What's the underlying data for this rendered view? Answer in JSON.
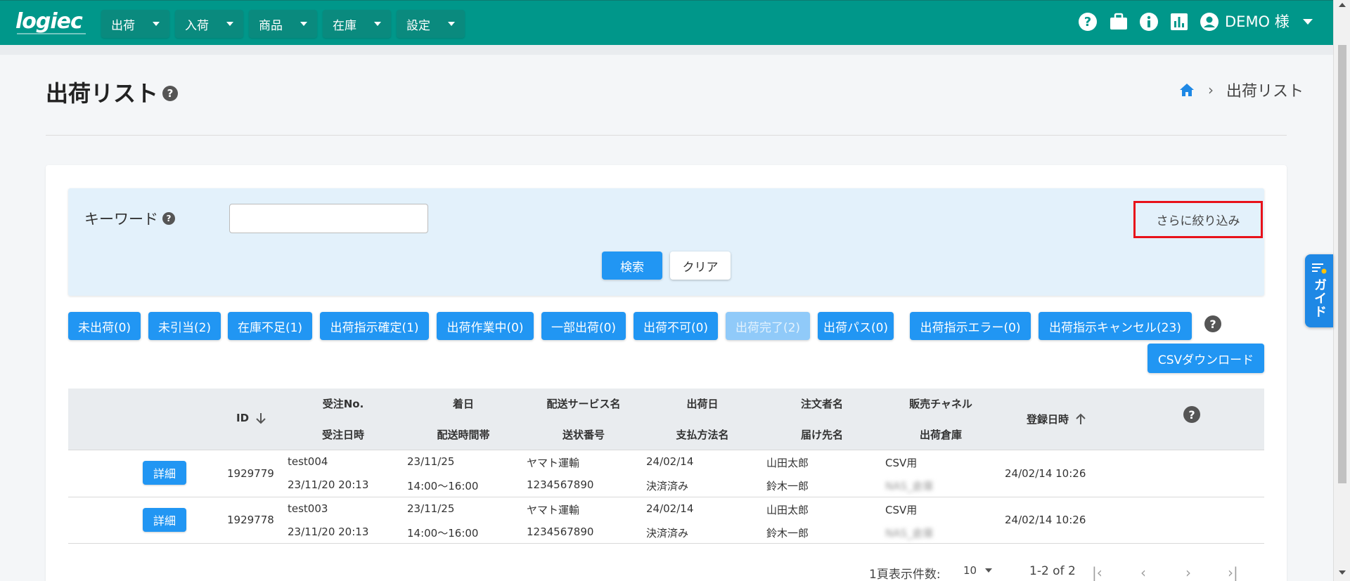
{
  "app": {
    "logo": "logiec"
  },
  "nav": {
    "menus": [
      {
        "label": "出荷"
      },
      {
        "label": "入荷"
      },
      {
        "label": "商品"
      },
      {
        "label": "在庫"
      },
      {
        "label": "設定"
      }
    ],
    "user": "DEMO 様"
  },
  "page": {
    "title": "出荷リスト",
    "breadcrumb_current": "出荷リスト"
  },
  "search": {
    "keyword_label": "キーワード",
    "keyword_value": "",
    "more_filter_label": "さらに絞り込み",
    "search_label": "検索",
    "clear_label": "クリア"
  },
  "statuses": [
    {
      "label": "未出荷(0)",
      "disabled": false
    },
    {
      "label": "未引当(2)",
      "disabled": false
    },
    {
      "label": "在庫不足(1)",
      "disabled": false
    },
    {
      "label": "出荷指示確定(1)",
      "disabled": false
    },
    {
      "label": "出荷作業中(0)",
      "disabled": false
    },
    {
      "label": "一部出荷(0)",
      "disabled": false
    },
    {
      "label": "出荷不可(0)",
      "disabled": false
    },
    {
      "label": "出荷完了(2)",
      "disabled": true
    },
    {
      "label": "出荷パス(0)",
      "disabled": false
    },
    {
      "label": "出荷指示エラー(0)",
      "disabled": false
    },
    {
      "label": "出荷指示キャンセル(23)",
      "disabled": false
    }
  ],
  "csv_download_label": "CSVダウンロード",
  "table": {
    "headers": {
      "id": "ID",
      "order_no": "受注No.",
      "order_date": "受注日時",
      "arrival_date": "着日",
      "time_slot": "配送時間帯",
      "service": "配送サービス名",
      "tracking": "送状番号",
      "ship_date": "出荷日",
      "payment": "支払方法名",
      "orderer": "注文者名",
      "recipient": "届け先名",
      "channel": "販売チャネル",
      "warehouse": "出荷倉庫",
      "registered": "登録日時"
    },
    "detail_label": "詳細",
    "rows": [
      {
        "id": "1929779",
        "order_no": "test004",
        "order_date": "23/11/20 20:13",
        "arrival_date": "23/11/25",
        "time_slot": "14:00～16:00",
        "service": "ヤマト運輸",
        "tracking": "1234567890",
        "ship_date": "24/02/14",
        "payment": "決済済み",
        "orderer": "山田太郎",
        "recipient": "鈴木一郎",
        "channel": "CSV用",
        "warehouse": "NAS_倉庫",
        "registered": "24/02/14 10:26"
      },
      {
        "id": "1929778",
        "order_no": "test003",
        "order_date": "23/11/20 20:13",
        "arrival_date": "23/11/25",
        "time_slot": "14:00～16:00",
        "service": "ヤマト運輸",
        "tracking": "1234567890",
        "ship_date": "24/02/14",
        "payment": "決済済み",
        "orderer": "山田太郎",
        "recipient": "鈴木一郎",
        "channel": "CSV用",
        "warehouse": "NAS_倉庫",
        "registered": "24/02/14 10:26"
      }
    ]
  },
  "pagination": {
    "per_page_label": "1頁表示件数:",
    "per_page_value": "10",
    "range": "1-2 of 2"
  },
  "guide_label": "ガイド",
  "colors": {
    "nav": "#00978a",
    "primary": "#2196f3",
    "highlight_border": "#e8121a"
  }
}
